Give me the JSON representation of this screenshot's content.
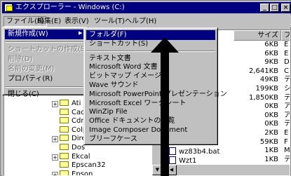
{
  "window": {
    "title": "エクスプローラー - Windows (C:)",
    "min": "_",
    "max": "□",
    "close": "×"
  },
  "menubar": [
    "ファイル(F)",
    "編集(E)",
    "表示(V)",
    "ツール(T)",
    "ヘルプ(H)"
  ],
  "file_menu": [
    {
      "label": "新規作成(W)",
      "state": "selected",
      "submenu": true
    },
    {
      "sep": true
    },
    {
      "label": "ショートカットの作成(S)",
      "state": "disabled"
    },
    {
      "label": "削除(D)",
      "state": "disabled"
    },
    {
      "label": "名前の変更(M)",
      "state": "disabled"
    },
    {
      "label": "プロパティ(R)",
      "state": "normal"
    },
    {
      "sep": true
    },
    {
      "label": "閉じる(C)",
      "state": "normal"
    }
  ],
  "new_submenu": [
    {
      "label": "フォルダ(F)",
      "state": "selected"
    },
    {
      "label": "ショートカット(S)",
      "state": "normal"
    },
    {
      "sep": true
    },
    {
      "label": "テキスト文書",
      "state": "normal"
    },
    {
      "label": "Microsoft Word 文書",
      "state": "normal"
    },
    {
      "label": "ビットマップ イメージ",
      "state": "normal"
    },
    {
      "label": "Wave サウンド",
      "state": "normal"
    },
    {
      "label": "Microsoft PowerPoint プレゼンテーション",
      "state": "normal"
    },
    {
      "label": "Microsoft Excel ワークシート",
      "state": "normal"
    },
    {
      "label": "WinZip File",
      "state": "normal"
    },
    {
      "label": "Office ドキュメントの一覧",
      "state": "normal"
    },
    {
      "label": "Image Composer Document",
      "state": "normal"
    },
    {
      "label": "ブリーフケース",
      "state": "normal"
    }
  ],
  "tree": [
    {
      "label": "Ati",
      "pm": "+"
    },
    {
      "label": "Cache",
      "pm": ""
    },
    {
      "label": "Cdrom",
      "pm": ""
    },
    {
      "label": "Colphoto",
      "pm": ""
    },
    {
      "label": "Direct95",
      "pm": "+"
    },
    {
      "label": "Dos",
      "pm": ""
    },
    {
      "label": "Ekcal",
      "pm": "+"
    },
    {
      "label": "Epscan32",
      "pm": ""
    },
    {
      "label": "Epson",
      "pm": "+"
    }
  ],
  "list": {
    "size_header": "サイズ",
    "type_header": "ファ",
    "sizes": [
      "6KB",
      "6KB",
      "9KB",
      "2,641KB",
      "49KB",
      "199KB",
      "1,850KB",
      "0KB",
      "0KB",
      "0KB",
      "2KB",
      "59KB",
      "1KB",
      "1KB"
    ],
    "types": [
      "E",
      "E",
      "D",
      "C",
      "テ",
      "シ",
      "テ",
      "ア",
      "ア",
      "テ",
      "E",
      "F",
      "M",
      "テ"
    ],
    "files": [
      {
        "name": "wz83b4.bat"
      },
      {
        "name": "Wzt1"
      }
    ],
    "k_label": "K"
  }
}
